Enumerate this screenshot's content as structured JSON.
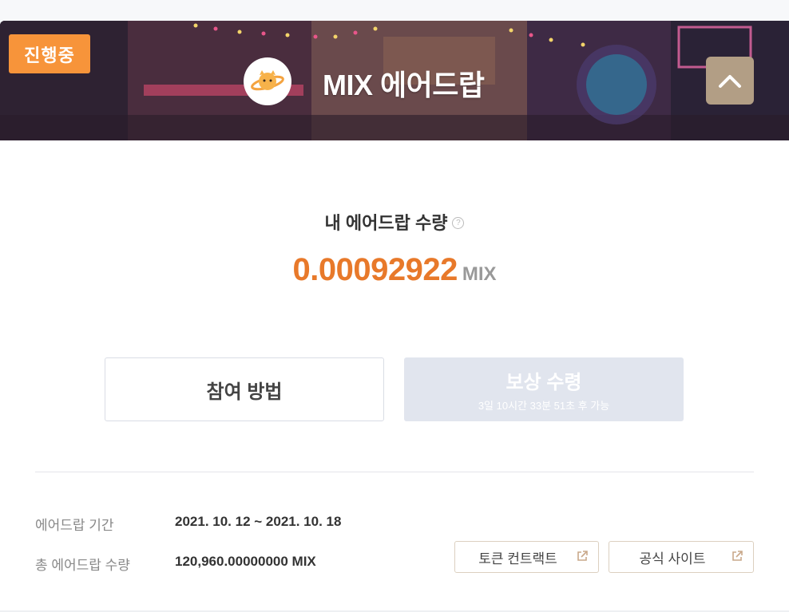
{
  "banner": {
    "status_badge": "진행중",
    "title": "MIX 에어드랍",
    "logo_icon": "planet-logo-icon",
    "collapse_icon": "chevron-up-icon"
  },
  "airdrop": {
    "my_amount_label": "내 에어드랍 수량",
    "help_icon": "?",
    "amount": "0.00092922",
    "unit": "MIX"
  },
  "buttons": {
    "how_to_participate": "참여 방법",
    "claim_reward": "보상 수령",
    "claim_countdown": "3일 10시간 33분 51초 후 가능"
  },
  "info": {
    "period_label": "에어드랍 기간",
    "period_value": "2021. 10. 12 ~ 2021. 10. 18",
    "total_label": "총 에어드랍 수량",
    "total_value": "120,960.00000000 MIX"
  },
  "links": {
    "token_contract": "토큰 컨트랙트",
    "official_site": "공식 사이트"
  },
  "colors": {
    "accent_orange": "#e8792a",
    "badge_orange": "#f7943a",
    "collapse_button": "#b29e85",
    "disabled_button": "#e1e5ee"
  }
}
